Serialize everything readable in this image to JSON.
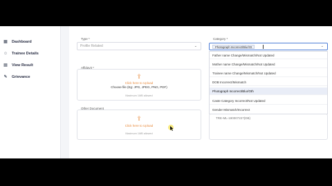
{
  "sidebar": {
    "items": [
      {
        "label": "Dashboard",
        "icon": "dashboard-icon"
      },
      {
        "label": "Trainee Details",
        "icon": "user-icon"
      },
      {
        "label": "View Result",
        "icon": "result-icon"
      },
      {
        "label": "Grievance",
        "icon": "grievance-icon"
      }
    ]
  },
  "form": {
    "type_label": "Type *",
    "type_value": "Profile Related",
    "affidavit_label": "Affidavit *",
    "affidavit_click": "Click here to Upload",
    "affidavit_choose": "Choose file (Eg: JPG, JPEG, PNG, PDF)",
    "affidavit_max": "Maximum 1MB allowed",
    "other_label": "Other Document",
    "other_click": "Click here to Upload",
    "other_max": "Maximum 1MB allowed",
    "category_label": "Category *",
    "category_chip": "Photograph Incorrect/Blur/Ot",
    "category_options": [
      "Father name Change/Mismatch/Not Updated",
      "Mother name Change/Mismatch/Not Updated",
      "Trainee name Change/Mismatch/Not Updated",
      "DOB Incorrect/Mismatch",
      "Photograph Incorrect/Blur/Oth",
      "Caste Category Incorrect/Not Updated",
      "Gender Mismatch/Incorrect"
    ],
    "category_selected_index": 4,
    "below_value": "TRE-ML-190007227(DB)"
  },
  "colors": {
    "accent": "#e8893a",
    "focus": "#4a7bd6"
  }
}
